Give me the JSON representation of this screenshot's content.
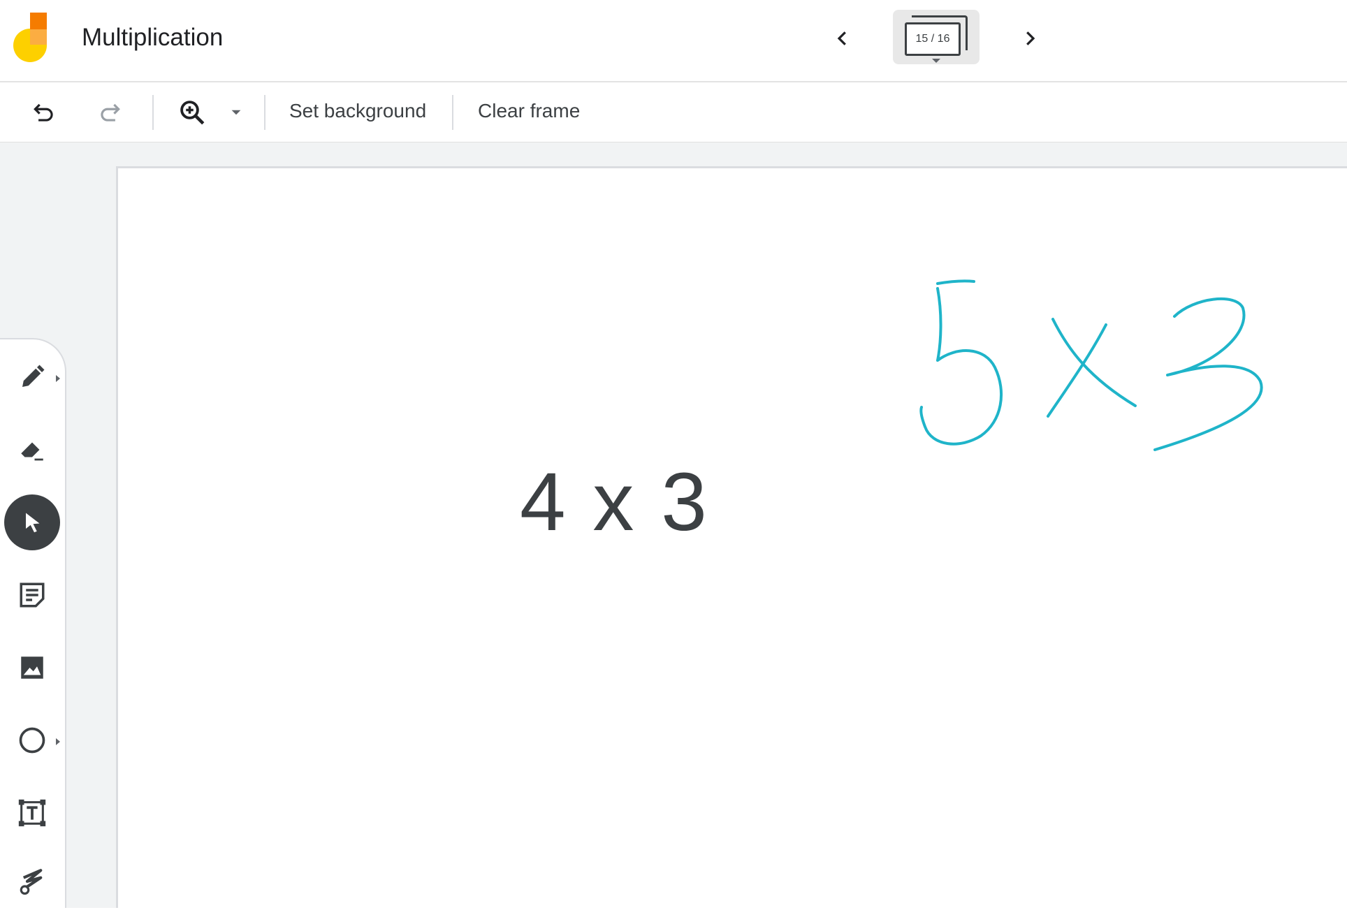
{
  "header": {
    "title": "Multiplication",
    "frame_counter": "15 / 16"
  },
  "toolbar": {
    "set_background_label": "Set background",
    "clear_frame_label": "Clear frame"
  },
  "canvas": {
    "typed_text": "4 x 3",
    "handwriting_text": "5x3",
    "ink_color": "#1fb4c9"
  },
  "tools": [
    {
      "name": "pen",
      "icon": "pen-icon",
      "has_submenu": true
    },
    {
      "name": "eraser",
      "icon": "eraser-icon"
    },
    {
      "name": "select",
      "icon": "cursor-icon",
      "active": true
    },
    {
      "name": "sticky-note",
      "icon": "sticky-note-icon"
    },
    {
      "name": "image",
      "icon": "image-icon"
    },
    {
      "name": "shape",
      "icon": "circle-icon",
      "has_submenu": true
    },
    {
      "name": "text-box",
      "icon": "text-box-icon"
    },
    {
      "name": "laser",
      "icon": "laser-icon"
    }
  ],
  "colors": {
    "brand_orange": "#f57c00",
    "brand_light_orange": "#fbad42",
    "brand_yellow": "#fdd000",
    "icon_gray": "#3c4043"
  }
}
